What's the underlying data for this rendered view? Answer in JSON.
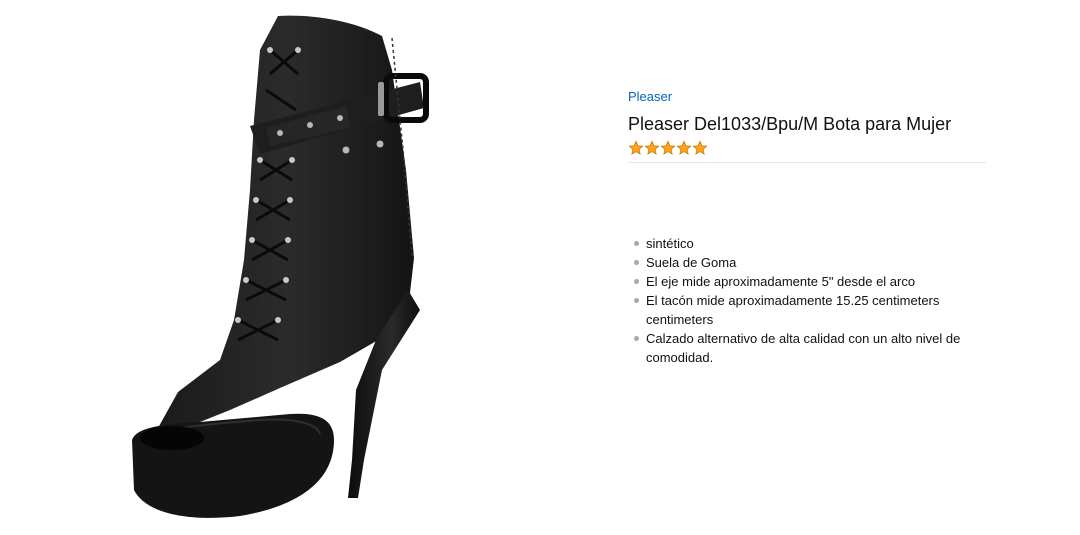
{
  "product": {
    "brand": "Pleaser",
    "title": "Pleaser Del1033/Bpu/M Bota para Mujer",
    "rating_stars": 5,
    "star_color": "#ffa41c",
    "image_icon": "boot-image"
  },
  "features": [
    "sintético",
    "Suela de Goma",
    "El eje mide aproximadamente 5\" desde el arco",
    "El tacón mide aproximadamente 15.25 centimeters centimeters",
    "Calzado alternativo de alta calidad con un alto nivel de comodidad."
  ]
}
